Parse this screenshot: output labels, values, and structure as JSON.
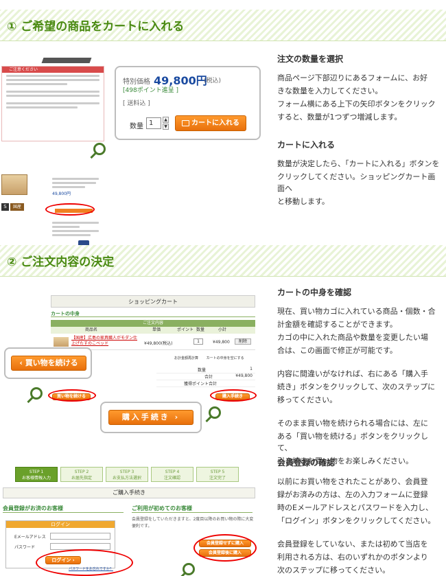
{
  "section1": {
    "title": "① ご希望の商品をカートに入れる",
    "block1": {
      "heading": "注文の数量を選択",
      "lines": [
        "商品ページ下部辺りにあるフォームに、お好",
        "きな数量を入力してください。",
        "フォーム横にある上下の矢印ボタンをクリック",
        "すると、数量が1つずつ増減します。"
      ]
    },
    "block2": {
      "heading": "カートに入れる",
      "lines": [
        "数量が決定したら、「カートに入れる」ボタンを",
        "クリックしてください。ショッピングカート画面へ",
        "と移動します。"
      ]
    },
    "mock": {
      "notice_label": "ご注意ください",
      "price_label": "特別価格",
      "price_value": "49,800円",
      "tax_note": "(税込)",
      "points": "[498ポイント進呈 ]",
      "shipping": "[ 送料込 ]",
      "qty_label": "数量",
      "qty_value": "1",
      "cart_button": "カートに入れる",
      "badges": [
        "S",
        "国産"
      ],
      "mini_price": "49,800円"
    }
  },
  "section2": {
    "title": "② ご注文内容の決定",
    "block1": {
      "heading": "カートの中身を確認",
      "para1": [
        "現在、買い物カゴに入れている商品・個数・合",
        "計金額を確認することができます。",
        "カゴの中に入れた商品や数量を変更したい場",
        "合は、この画面で修正が可能です。"
      ],
      "para2": [
        "内容に間違いがなければ、右にある「購入手",
        "続き」ボタンをクリックして、次のステップに",
        "移ってください。"
      ],
      "para3": [
        "そのまま買い物を続けられる場合には、左に",
        "ある「買い物を続ける」ボタンをクリックして、",
        "引き続きお買い物をお楽しみください。"
      ]
    },
    "block2": {
      "heading": "会員登録の確認",
      "para1": [
        "以前にお買い物をされたことがあり、会員登",
        "録がお済みの方は、左の入力フォームに登録",
        "時のEメールアドレスとパスワードを入力し、",
        "「ログイン」ボタンをクリックしてください。"
      ],
      "para2": [
        "会員登録をしていない、または初めて当店を",
        "利用される方は、右のいずれかのボタンより",
        "次のステップに移ってください。"
      ]
    },
    "cart_mock": {
      "header": "ショッピングカート",
      "sub": "カートの中身",
      "table_title": "ご注文内容",
      "columns": [
        "商品名",
        "単価",
        "ポイント",
        "数量",
        "小計"
      ],
      "row_name": "【国産】広島の家具職人がモダン仕上げたすのこベッド",
      "row_price": "¥49,800(税込)",
      "row_qty": "1",
      "row_subtotal": "¥49,800",
      "delete_label": "削除",
      "links": [
        "お計金額再計算",
        "カートの中身を空にする"
      ],
      "totals": [
        {
          "label": "数量",
          "value": "1"
        },
        {
          "label": "合計",
          "value": "¥49,800"
        },
        {
          "label": "獲得ポイント合計",
          "value": ""
        }
      ],
      "continue_small": "買い物を続ける",
      "purchase_small": "購入手続き"
    },
    "continue_button": "買い物を続ける",
    "purchase_button": "購入手続き",
    "steps": [
      {
        "num": "STEP 1",
        "label": "お客様情報入力"
      },
      {
        "num": "STEP 2",
        "label": "お届先指定"
      },
      {
        "num": "STEP 3",
        "label": "お支払方法選択"
      },
      {
        "num": "STEP 4",
        "label": "注文確認"
      },
      {
        "num": "STEP 5",
        "label": "注文完了"
      }
    ],
    "procedure_header": "ご購入手続き",
    "member_head": "会員登録がお済のお客様",
    "new_head": "ご利用が初めてのお客様",
    "login_title": "ログイン",
    "email_label": "Eメールアドレス",
    "password_label": "パスワード",
    "login_button": "ログイン",
    "forgot_link": "パスワードをお忘れですか？",
    "new_text": "会員登録をしていただきますと、2度目以降のお買い物の際に大変便利です。",
    "btn_without_register": "会員登録せずに購入",
    "btn_register_then_buy": "会員登録後に購入"
  }
}
